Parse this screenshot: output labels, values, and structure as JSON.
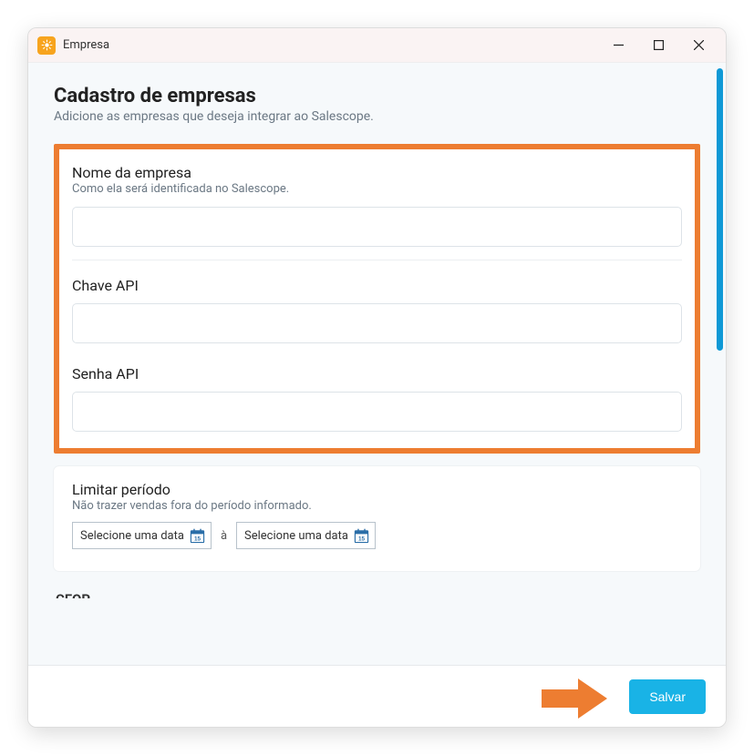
{
  "window": {
    "title": "Empresa"
  },
  "page": {
    "title": "Cadastro de empresas",
    "subtitle": "Adicione as empresas que deseja integrar ao Salescope."
  },
  "fields": {
    "company_name": {
      "label": "Nome da empresa",
      "hint": "Como ela será identificada no Salescope.",
      "value": ""
    },
    "api_key": {
      "label": "Chave API",
      "value": ""
    },
    "api_password": {
      "label": "Senha API",
      "value": ""
    },
    "period": {
      "label": "Limitar período",
      "hint": "Não trazer vendas fora do período informado.",
      "from_placeholder": "Selecione uma data",
      "separator": "à",
      "to_placeholder": "Selecione uma data"
    }
  },
  "footer": {
    "save_label": "Salvar"
  },
  "cutoff": "CFOP",
  "colors": {
    "accent": "#19b3e6",
    "highlight": "#ed7d31",
    "scrollbar": "#0f99d6"
  }
}
